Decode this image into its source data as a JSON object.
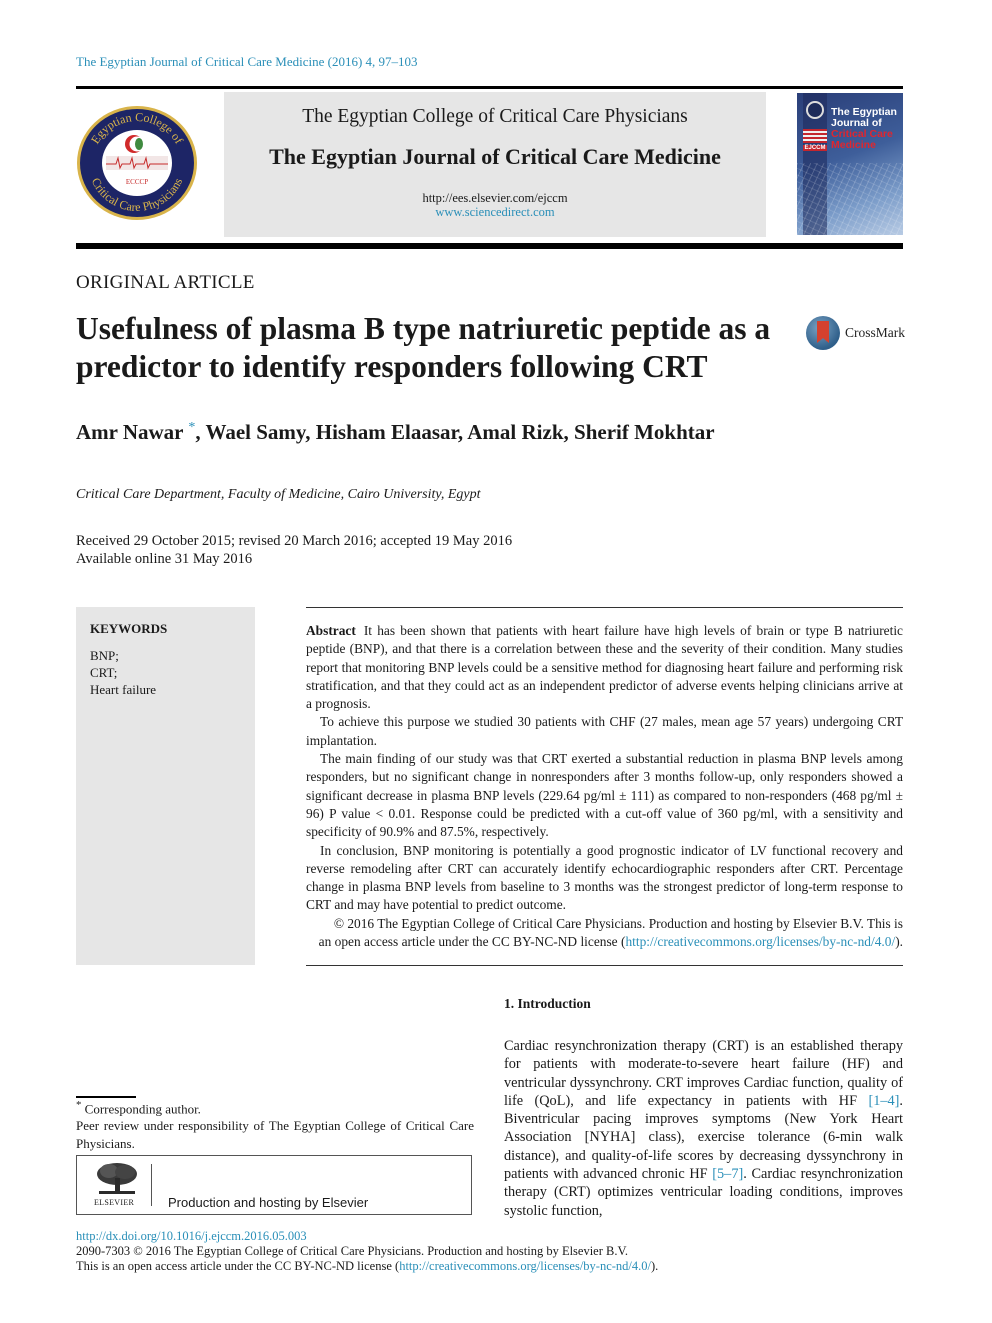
{
  "header": {
    "journal_ref": "The Egyptian Journal of Critical Care Medicine (2016) 4, 97–103",
    "college": "The Egyptian College of Critical Care Physicians",
    "journal_name": "The Egyptian Journal of Critical Care Medicine",
    "url_ees": "http://ees.elsevier.com/ejccm",
    "url_sciencedirect": "www.sciencedirect.com",
    "logo_text": {
      "ring_top": "Egyptian College of",
      "ring_bottom": "Critical Care Physicians",
      "acronym": "ECCCP"
    },
    "cover": {
      "line1": "The Egyptian Journal of",
      "line2": "Critical Care Medicine",
      "badge": "EJCCM"
    }
  },
  "article": {
    "section_label": "ORIGINAL ARTICLE",
    "title": "Usefulness of plasma B type natriuretic peptide as a predictor to identify responders following CRT",
    "crossmark_label": "CrossMark",
    "authors_first": "Amr Nawar",
    "corresponding_mark": "*",
    "authors_rest": ", Wael Samy, Hisham Elaasar, Amal Rizk, Sherif Mokhtar",
    "affiliation": "Critical Care Department, Faculty of Medicine, Cairo University, Egypt",
    "dates_line1": "Received 29 October 2015; revised 20 March 2016; accepted 19 May 2016",
    "dates_line2": "Available online 31 May 2016"
  },
  "keywords": {
    "heading": "KEYWORDS",
    "items": [
      "BNP;",
      "CRT;",
      "Heart failure"
    ]
  },
  "abstract": {
    "label": "Abstract",
    "p1": "It has been shown that patients with heart failure have high levels of brain or type B natriuretic peptide (BNP), and that there is a correlation between these and the severity of their condition. Many studies report that monitoring BNP levels could be a sensitive method for diagnosing heart failure and performing risk stratification, and that they could act as an independent predictor of adverse events helping clinicians arrive at a prognosis.",
    "p2": "To achieve this purpose we studied 30 patients with CHF (27 males, mean age 57 years) undergoing CRT implantation.",
    "p3": "The main finding of our study was that CRT exerted a substantial reduction in plasma BNP levels among responders, but no significant change in nonresponders after 3 months follow-up, only responders showed a significant decrease in plasma BNP levels (229.64 pg/ml ± 111) as compared to non-responders (468 pg/ml ± 96) P value < 0.01. Response could be predicted with a cut-off value of 360 pg/ml, with a sensitivity and specificity of 90.9% and 87.5%, respectively.",
    "p4": "In conclusion, BNP monitoring is potentially a good prognostic indicator of LV functional recovery and reverse remodeling after CRT can accurately identify echocardiographic responders after CRT. Percentage change in plasma BNP levels from baseline to 3 months was the strongest predictor of long-term response to CRT and may have potential to predict outcome.",
    "copyright": "© 2016 The Egyptian College of Critical Care Physicians. Production and hosting by Elsevier B.V. This is an open access article under the CC BY-NC-ND license (",
    "license_url": "http://creativecommons.org/licenses/by-nc-nd/4.0/",
    "copyright_end": ")."
  },
  "introduction": {
    "heading": "1. Introduction",
    "text_a": "Cardiac resynchronization therapy (CRT) is an established therapy for patients with moderate-to-severe heart failure (HF) and ventricular dyssynchrony. CRT improves Cardiac function, quality of life (QoL), and life expectancy in patients with HF ",
    "ref1": "[1–4]",
    "text_b": ". Biventricular pacing improves symptoms (New York Heart Association [NYHA] class), exercise tolerance (6-min walk distance), and quality-of-life scores by decreasing dyssynchrony in patients with advanced chronic HF ",
    "ref2": "[5–7]",
    "text_c": ". Cardiac resynchronization therapy (CRT) optimizes ventricular loading conditions, improves systolic function,"
  },
  "footnotes": {
    "mark": "*",
    "corresponding": "Corresponding author.",
    "peer_review": "Peer review under responsibility of The Egyptian College of Critical Care Physicians.",
    "publisher_name": "ELSEVIER",
    "production": "Production and hosting by Elsevier"
  },
  "footer": {
    "doi": "http://dx.doi.org/10.1016/j.ejccm.2016.05.003",
    "issn_line": "2090-7303 © 2016 The Egyptian College of Critical Care Physicians. Production and hosting by Elsevier B.V.",
    "license_prefix": "This is an open access article under the CC BY-NC-ND license (",
    "license_url": "http://creativecommons.org/licenses/by-nc-nd/4.0/",
    "license_suffix": ")."
  },
  "colors": {
    "link": "#2a8fb8",
    "banner_bg": "#e6e6e6",
    "logo_ring": "#1d2566",
    "logo_gold": "#d9b44a"
  }
}
